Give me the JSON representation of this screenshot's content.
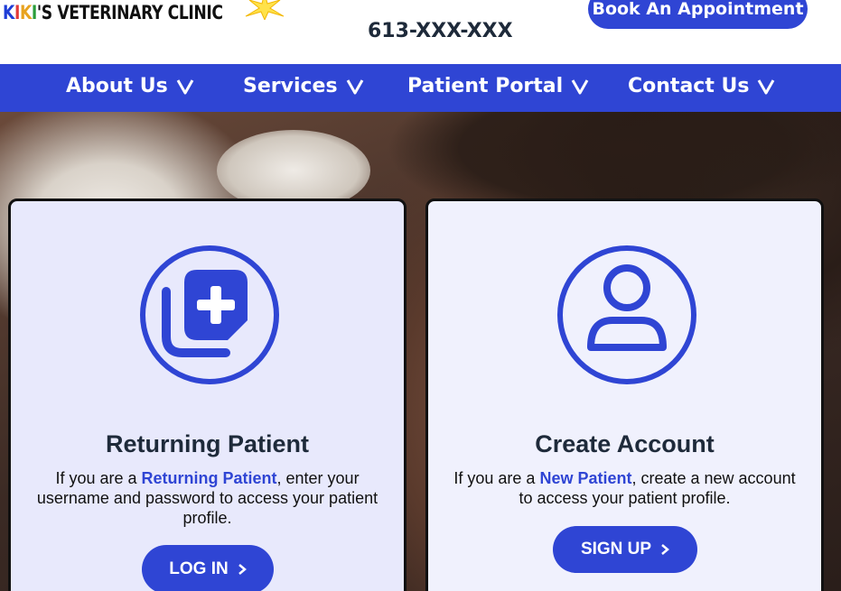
{
  "header": {
    "logo_parts": [
      "K",
      "I",
      "K",
      "I",
      "'S VETERINARY CLINIC"
    ],
    "phone": "613-XXX-XXX",
    "book_button": "Book An Appointment"
  },
  "nav": {
    "items": [
      {
        "label": "About Us"
      },
      {
        "label": "Services"
      },
      {
        "label": "Patient Portal"
      },
      {
        "label": "Contact Us"
      }
    ]
  },
  "cards": {
    "returning": {
      "title": "Returning Patient",
      "text_before": "If you are a ",
      "highlight": "Returning Patient",
      "text_after": ", enter your username and password to access your patient profile.",
      "button": "LOG IN",
      "icon": "medical-records-icon"
    },
    "create": {
      "title": "Create Account",
      "text_before": "If you are a ",
      "highlight": "New Patient",
      "text_after": ", create a new account to access your patient profile.",
      "button": "SIGN UP",
      "icon": "user-icon"
    }
  },
  "colors": {
    "brand_blue": "#2f45d4",
    "card_bg": "#e8e9fc",
    "text_dark": "#1e2a3a"
  }
}
